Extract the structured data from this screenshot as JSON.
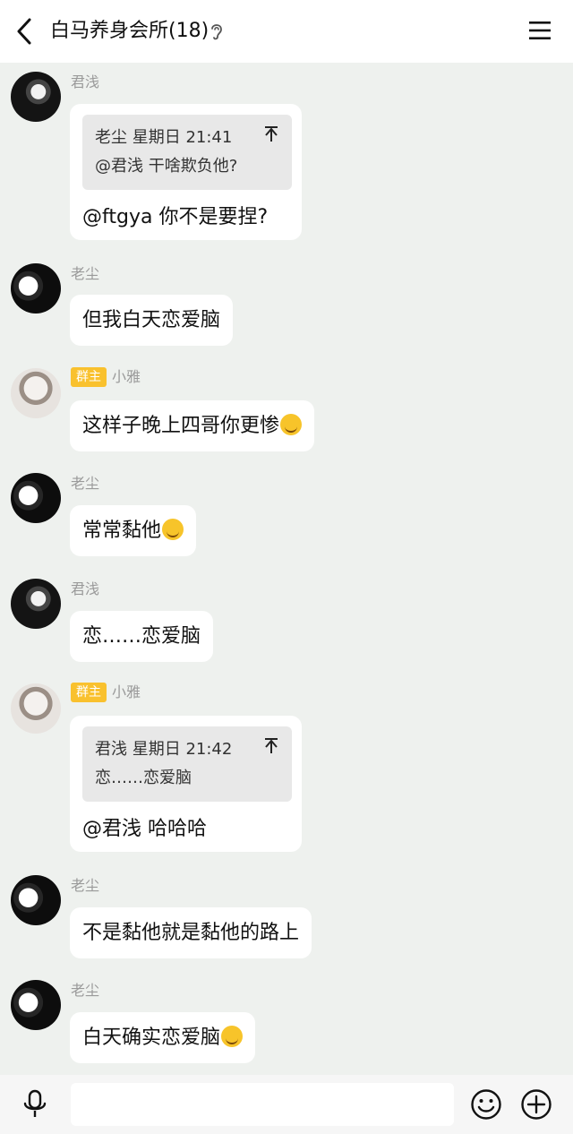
{
  "header": {
    "title": "白马养身会所(18)"
  },
  "messages": [
    {
      "sender": "君浅",
      "owner_badge": "",
      "quote": {
        "header": "老尘 星期日 21:41",
        "text": "@君浅 干啥欺负他?"
      },
      "text": "@ftgya 你不是要捏?",
      "emoji": ""
    },
    {
      "sender": "老尘",
      "owner_badge": "",
      "text": "但我白天恋爱脑",
      "emoji": ""
    },
    {
      "sender": "小雅",
      "owner_badge": "群主",
      "text": "这样子晚上四哥你更惨",
      "emoji": "laughing-tears"
    },
    {
      "sender": "老尘",
      "owner_badge": "",
      "text": "常常黏他",
      "emoji": "laughing-tears"
    },
    {
      "sender": "君浅",
      "owner_badge": "",
      "text": "恋……恋爱脑",
      "emoji": ""
    },
    {
      "sender": "小雅",
      "owner_badge": "群主",
      "quote": {
        "header": "君浅 星期日 21:42",
        "text": "恋……恋爱脑"
      },
      "text": "@君浅 哈哈哈",
      "emoji": ""
    },
    {
      "sender": "老尘",
      "owner_badge": "",
      "text": "不是黏他就是黏他的路上",
      "emoji": ""
    },
    {
      "sender": "老尘",
      "owner_badge": "",
      "text": "白天确实恋爱脑",
      "emoji": "smug"
    }
  ],
  "input": {
    "placeholder": ""
  },
  "colors": {
    "background": "#eef1ee",
    "owner_badge": "#f9c12e",
    "bubble": "#ffffff"
  },
  "icons": {
    "back": "chevron-left-icon",
    "ear": "ear-icon",
    "menu": "menu-icon",
    "quote_jump": "jump-to-quote-icon",
    "mic": "microphone-icon",
    "emoji": "emoji-icon",
    "plus": "plus-circle-icon"
  }
}
